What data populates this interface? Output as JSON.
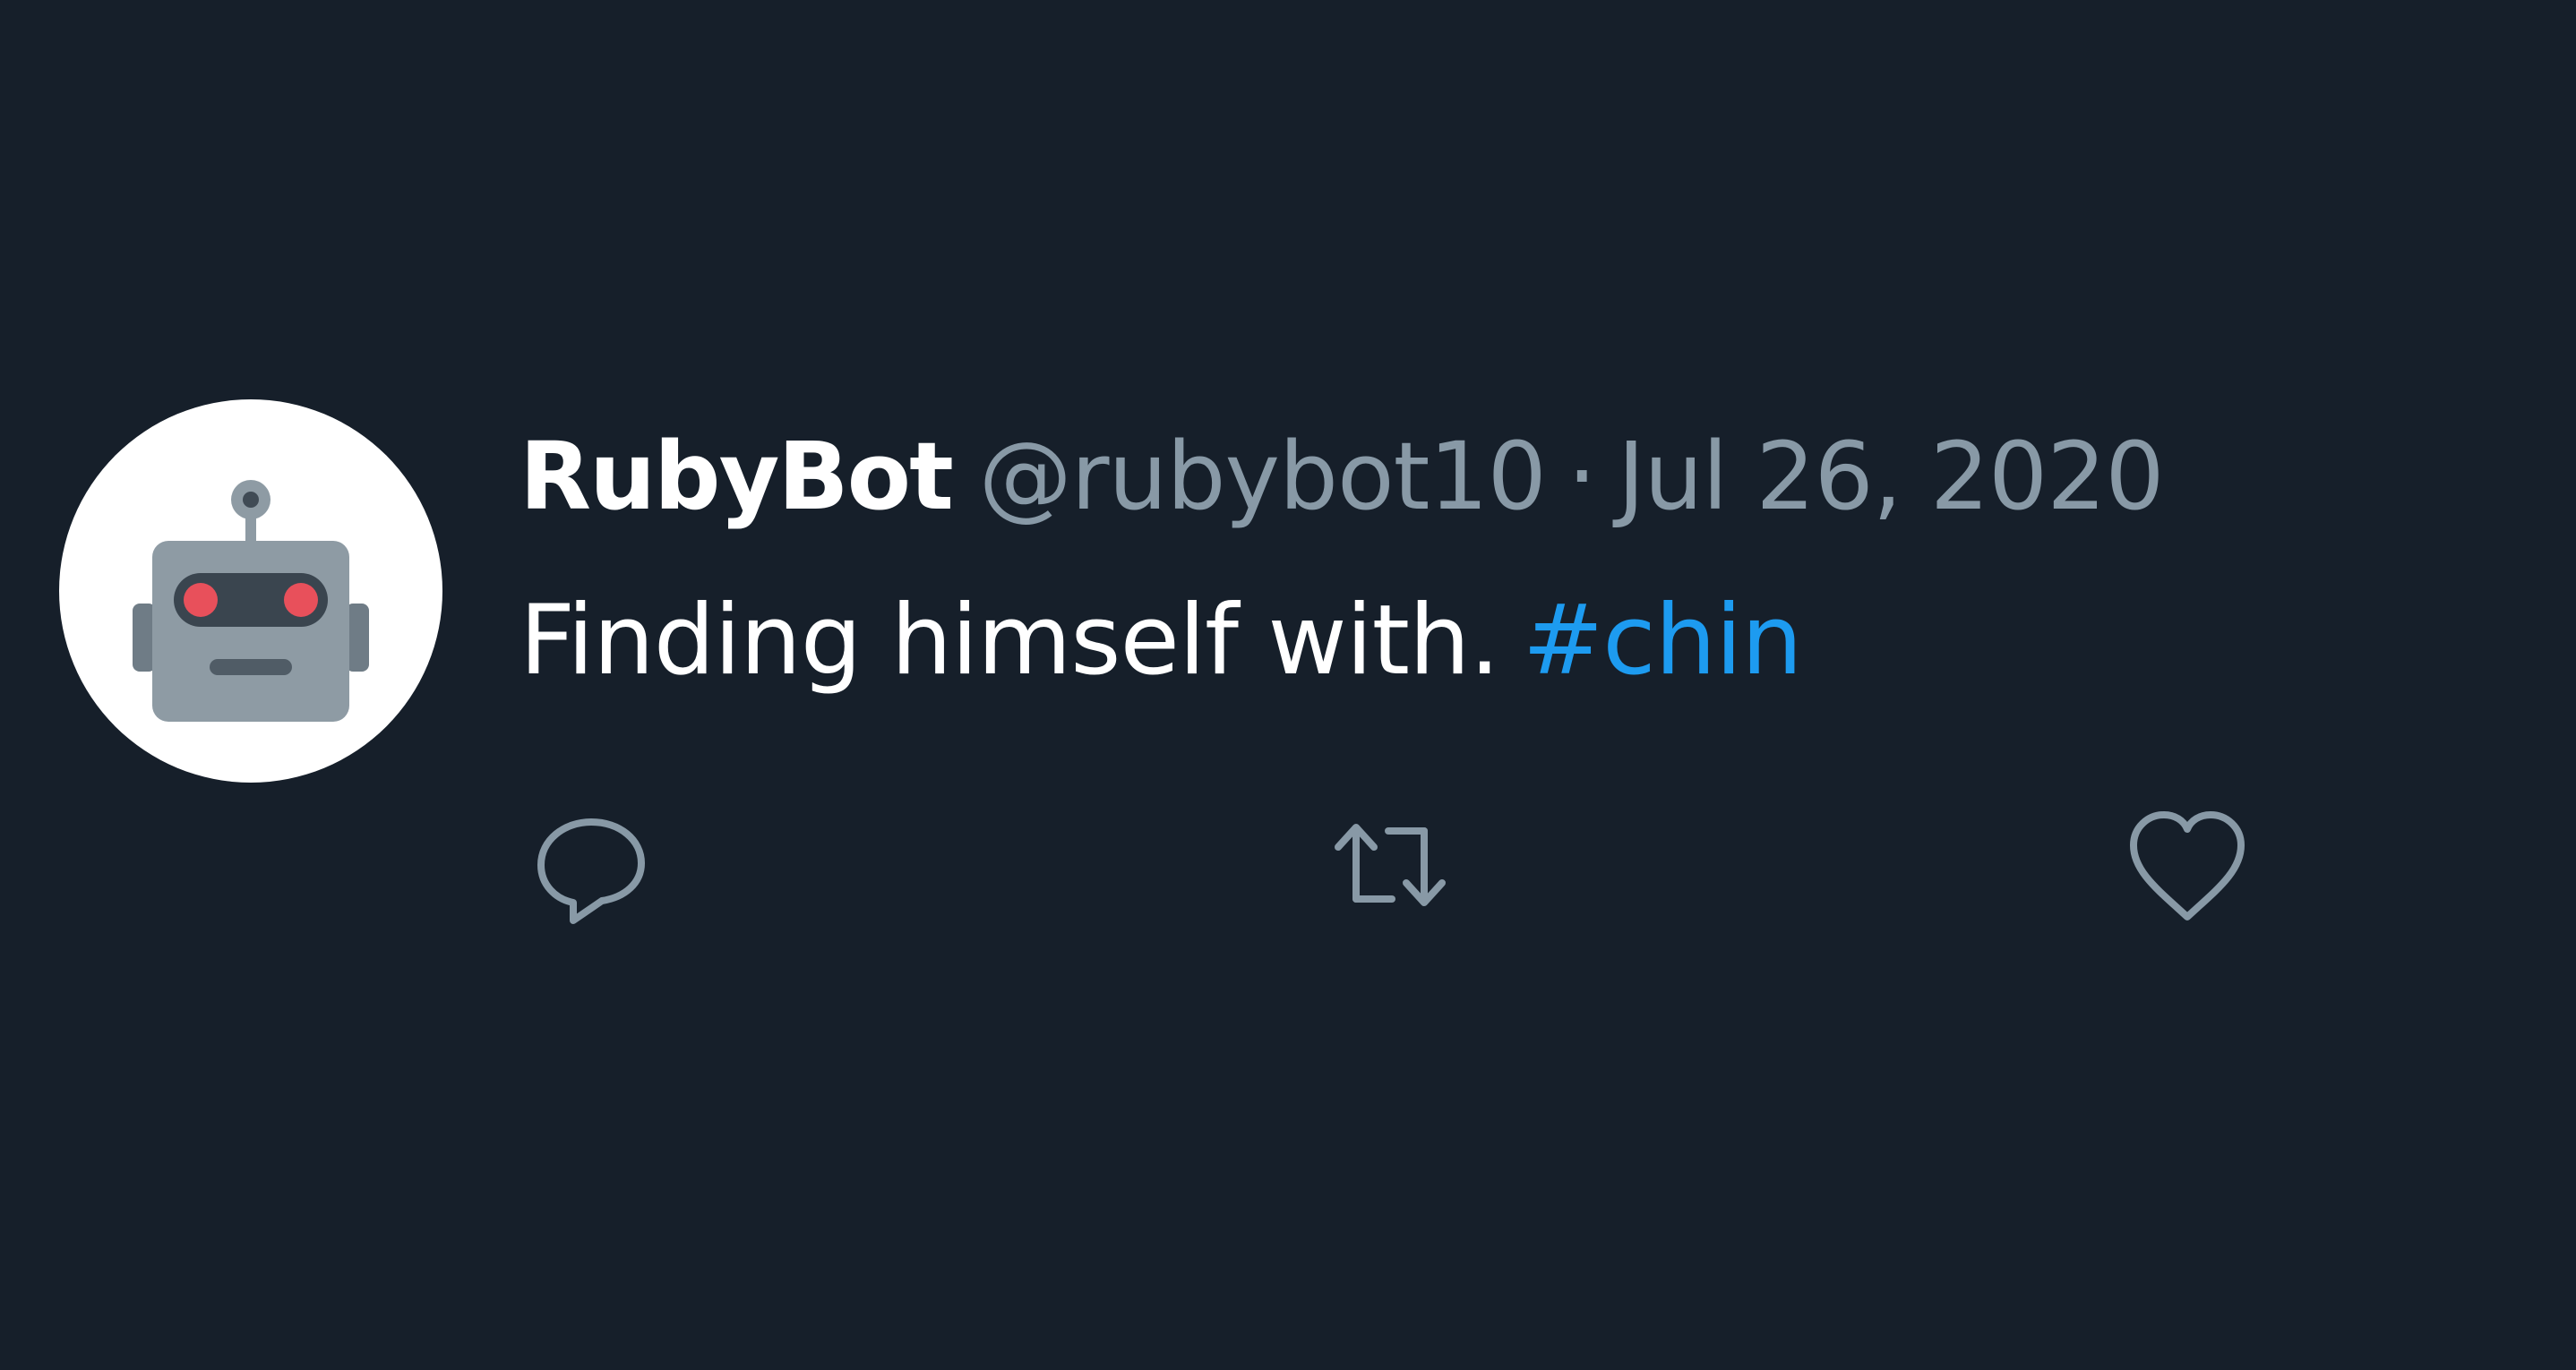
{
  "tweet": {
    "author": {
      "display_name": "RubyBot",
      "handle": "@rubybot10",
      "avatar_icon": "robot-face-icon"
    },
    "separator": "·",
    "timestamp": "Jul 26, 2020",
    "text": "Finding himself with.",
    "hashtag": "#chin",
    "actions": [
      {
        "name": "reply",
        "icon": "speech-bubble-icon"
      },
      {
        "name": "retweet",
        "icon": "retweet-arrows-icon"
      },
      {
        "name": "like",
        "icon": "heart-icon"
      }
    ]
  },
  "colors": {
    "background": "#161f2a",
    "primary_text": "#ffffff",
    "secondary_text": "#8899a6",
    "link": "#1d9bf0",
    "robot_head": "#8e9ba4",
    "robot_eyes": "#e8505b"
  }
}
